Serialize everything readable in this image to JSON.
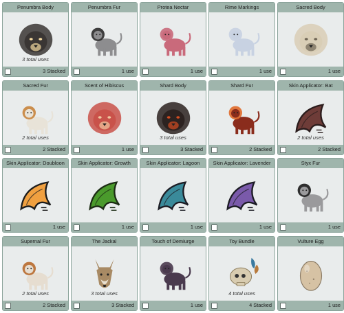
{
  "items": [
    {
      "name": "Penumbra Body",
      "uses": "3 total uses",
      "count": "3 Stacked",
      "icon": "dark-lion-head-icon",
      "color": "#3a3634",
      "accent": "#f2d8a0"
    },
    {
      "name": "Penumbra Fur",
      "uses": "",
      "count": "1 use",
      "icon": "grey-lion-icon",
      "color": "#8d8d8f",
      "accent": "#2b2b2b"
    },
    {
      "name": "Protea Nectar",
      "uses": "",
      "count": "1 use",
      "icon": "pink-lioness-icon",
      "color": "#c96a7b",
      "accent": "#e0a25c"
    },
    {
      "name": "Rime Markings",
      "uses": "",
      "count": "1 use",
      "icon": "frost-lioness-icon",
      "color": "#c8d2e2",
      "accent": "#8d9ab2"
    },
    {
      "name": "Sacred Body",
      "uses": "",
      "count": "1 use",
      "icon": "pale-lion-head-icon",
      "color": "#d9ceb6",
      "accent": "#6f6656"
    },
    {
      "name": "Sacred Fur",
      "uses": "2 total uses",
      "count": "2 Stacked",
      "icon": "maned-lion-icon",
      "color": "#e8e3d8",
      "accent": "#c8843c"
    },
    {
      "name": "Scent of Hibiscus",
      "uses": "",
      "count": "1 use",
      "icon": "red-lion-head-icon",
      "color": "#c9524a",
      "accent": "#f0c8a0"
    },
    {
      "name": "Shard Body",
      "uses": "3 total uses",
      "count": "3 Stacked",
      "icon": "black-lion-head-icon",
      "color": "#2c2220",
      "accent": "#d14c22"
    },
    {
      "name": "Shard Fur",
      "uses": "",
      "count": "2 Stacked",
      "icon": "fire-lion-icon",
      "color": "#8a2c1c",
      "accent": "#e06a2a"
    },
    {
      "name": "Skin Applicator: Bat",
      "uses": "2 total uses",
      "count": "2 Stacked",
      "icon": "bat-wing-icon",
      "color": "#6e3c38",
      "accent": "#2a1c1c"
    },
    {
      "name": "Skin Applicator: Doubloon",
      "uses": "",
      "count": "1 use",
      "icon": "orange-wave-icon",
      "color": "#f0a040",
      "accent": "#1c1c1c"
    },
    {
      "name": "Skin Applicator: Growth",
      "uses": "",
      "count": "1 use",
      "icon": "green-wave-icon",
      "color": "#4a9a2c",
      "accent": "#1c2c14"
    },
    {
      "name": "Skin Applicator: Lagoon",
      "uses": "",
      "count": "1 use",
      "icon": "teal-wave-icon",
      "color": "#3a8a9a",
      "accent": "#1c1c24"
    },
    {
      "name": "Skin Applicator: Lavender",
      "uses": "",
      "count": "1 use",
      "icon": "purple-wave-icon",
      "color": "#7a5aaa",
      "accent": "#1c1c24"
    },
    {
      "name": "Styx Fur",
      "uses": "",
      "count": "1 use",
      "icon": "styx-lion-icon",
      "color": "#9a9a9c",
      "accent": "#1a1a1a"
    },
    {
      "name": "Supernal Fur",
      "uses": "2 total uses",
      "count": "2 Stacked",
      "icon": "golden-maned-lion-icon",
      "color": "#e6ddd0",
      "accent": "#b86a2c"
    },
    {
      "name": "The Jackal",
      "uses": "3 total uses",
      "count": "3 Stacked",
      "icon": "jackal-head-icon",
      "color": "#a88a64",
      "accent": "#e8e0d0"
    },
    {
      "name": "Touch of Demiurge",
      "uses": "",
      "count": "1 use",
      "icon": "purple-lioness-icon",
      "color": "#4a3a4e",
      "accent": "#8a6a8e"
    },
    {
      "name": "Toy Bundle",
      "uses": "4 total uses",
      "count": "4 Stacked",
      "icon": "skull-feather-icon",
      "color": "#d8ccb0",
      "accent": "#3a7aa0"
    },
    {
      "name": "Vulture Egg",
      "uses": "",
      "count": "1 use",
      "icon": "egg-icon",
      "color": "#d6c2a4",
      "accent": "#8a7a64"
    }
  ]
}
